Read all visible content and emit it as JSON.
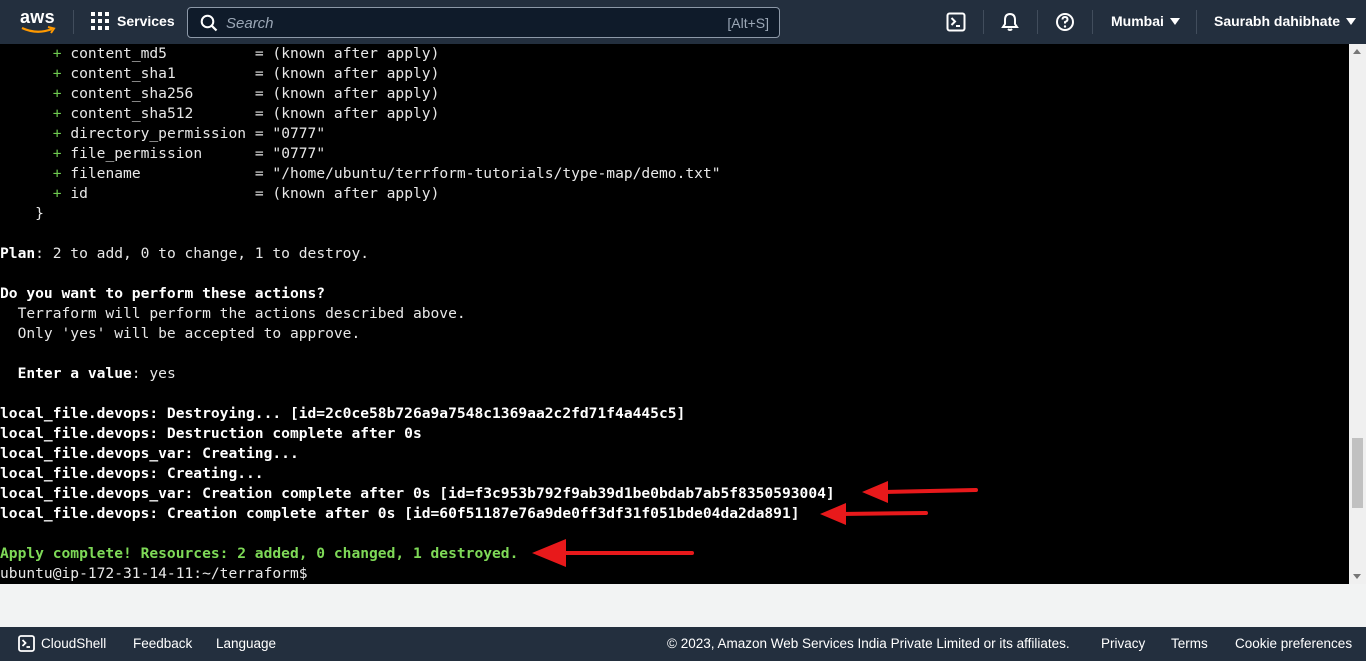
{
  "topnav": {
    "logo_text": "aws",
    "services_label": "Services",
    "search_placeholder": "Search",
    "search_shortcut": "[Alt+S]",
    "region": "Mumbai",
    "user": "Saurabh dahibhate",
    "icons": [
      "cloudshell-icon",
      "notifications-bell-icon",
      "help-icon"
    ]
  },
  "terminal": {
    "attr_lines": [
      {
        "indent": "      ",
        "prefix": "+",
        "key": "content_md5         ",
        "value": "= (known after apply)"
      },
      {
        "indent": "      ",
        "prefix": "+",
        "key": "content_sha1        ",
        "value": "= (known after apply)"
      },
      {
        "indent": "      ",
        "prefix": "+",
        "key": "content_sha256      ",
        "value": "= (known after apply)"
      },
      {
        "indent": "      ",
        "prefix": "+",
        "key": "content_sha512      ",
        "value": "= (known after apply)"
      },
      {
        "indent": "      ",
        "prefix": "+",
        "key": "directory_permission",
        "value": "= \"0777\""
      },
      {
        "indent": "      ",
        "prefix": "+",
        "key": "file_permission     ",
        "value": "= \"0777\""
      },
      {
        "indent": "      ",
        "prefix": "+",
        "key": "filename            ",
        "value": "= \"/home/ubuntu/terrform-tutorials/type-map/demo.txt\""
      },
      {
        "indent": "      ",
        "prefix": "+",
        "key": "id                  ",
        "value": "= (known after apply)"
      }
    ],
    "close_brace": "    }",
    "plan_label": "Plan",
    "plan_text": ": 2 to add, 0 to change, 1 to destroy.",
    "question": "Do you want to perform these actions?",
    "info_1": "  Terraform will perform the actions described above.",
    "info_2": "  Only 'yes' will be accepted to approve.",
    "enter_label": "  Enter a value",
    "enter_colon": ": ",
    "enter_value": "yes",
    "output": [
      "local_file.devops: Destroying... [id=2c0ce58b726a9a7548c1369aa2c2fd71f4a445c5]",
      "local_file.devops: Destruction complete after 0s",
      "local_file.devops_var: Creating...",
      "local_file.devops: Creating...",
      "local_file.devops_var: Creation complete after 0s [id=f3c953b792f9ab39d1be0bdab7ab5f8350593004]",
      "local_file.devops: Creation complete after 0s [id=60f51187e76a9de0ff3df31f051bde04da2da891]"
    ],
    "apply_complete": "Apply complete! Resources: 2 added, 0 changed, 1 destroyed.",
    "prompt": "ubuntu@ip-172-31-14-11:~/terraform$"
  },
  "annotation_color": "#e8191b",
  "footer": {
    "cloudshell": "CloudShell",
    "feedback": "Feedback",
    "language": "Language",
    "copyright": "© 2023, Amazon Web Services India Private Limited or its affiliates.",
    "privacy": "Privacy",
    "terms": "Terms",
    "cookie": "Cookie preferences"
  }
}
